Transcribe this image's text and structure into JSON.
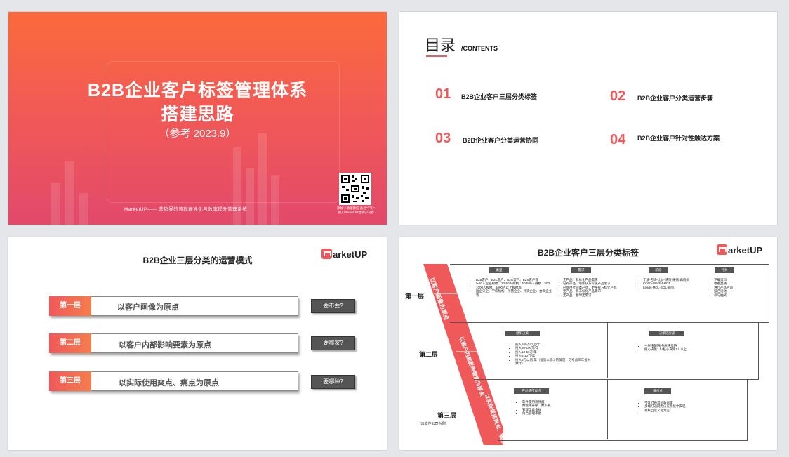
{
  "slide1": {
    "title_line1": "B2B企业客户标签管理体系",
    "title_line2": "搭建思路",
    "subtitle": "（参考   2023.9）",
    "footer": "MarketUP——  营销界的流程标准化与效率提升管理系统",
    "qr_caption_1": "添加小助理微信 备注\"学习\"",
    "qr_caption_2": "加入MarketUP营销学习群"
  },
  "slide2": {
    "title": "目录",
    "title_en": "/CONTENTS",
    "items": [
      {
        "num": "01",
        "text": "B2B企业客户三层分类标签"
      },
      {
        "num": "02",
        "text": "B2B企业客户分类运营步骤"
      },
      {
        "num": "03",
        "text": "B2B企业客户分类运营协同"
      },
      {
        "num": "04",
        "text": "B2B企业客户针对性触达方案"
      }
    ]
  },
  "slide3": {
    "title": "B2B企业三层分类的运营模式",
    "logo": "arketUP",
    "layers": [
      {
        "tag": "第一层",
        "text": "以客户画像为原点",
        "question": "要不要?"
      },
      {
        "tag": "第二层",
        "text": "以客户内部影响要素为原点",
        "question": "要哪家?"
      },
      {
        "tag": "第三层",
        "text": "以实际使用爽点、痛点为原点",
        "question": "要哪种?"
      }
    ]
  },
  "slide4": {
    "title": "B2B企业客户三层分类标签",
    "logo": "arketUP",
    "levels": [
      "第一层",
      "第二层",
      "第三层"
    ],
    "level3_note": "(以软件公司为例)",
    "bands": [
      "以客户画像为原点",
      "以客户内部影响要素为原点",
      "以实际使用爽点、痛点为原点"
    ],
    "row1": [
      {
        "header": "类型",
        "items": [
          "B2B客户、B2C客户、B2G客户、B2S客户等",
          "0-20人企业规模、20-50人规模、50-500人规模、500-1000人规模、1000人以上规模等",
          "国企央企、学校机构、民营企业、外资企业、合资企业等"
        ]
      },
      {
        "header": "需求",
        "items": [
          "无产品、有标化产品需求",
          "已有产品，增加获方标化产品需求",
          "已使用过同类产品，更换提方标化产品",
          "无产品、有非标化产品需求",
          "无产品，暂时无需求"
        ]
      },
      {
        "header": "阶段",
        "items": [
          "了解-咨询-比价-决策-采购-再购买",
          "COLD-WARM-HOT",
          "Leads-MQL-SQL-商机"
        ]
      },
      {
        "header": "行为",
        "items": [
          "下载资料",
          "收看直播",
          "进行产品咨询",
          "报名活动",
          "参与抽奖"
        ]
      }
    ],
    "row2": [
      {
        "header": "组织决策",
        "items": [
          "投入100万以上/年",
          "投入50-100万/年",
          "投入10-50万/年",
          "投入5-10万/年",
          "投入5万以内/年（投资人较少的情况，可考虑三年投入预计）"
        ]
      },
      {
        "header": "决策链层级",
        "items": [
          "一层决策链/多层决策链",
          "核心决策1人/核心决策1人以上"
        ]
      }
    ],
    "row3": [
      {
        "header": "产品使用爽点",
        "items": [
          "软件使用流畅度",
          "数据库升级、数下载",
          "管理工具多样",
          "角色管理丰富"
        ]
      },
      {
        "header": "痛点点",
        "items": [
          "不爱打通其他数据库",
          "多端打通网无法在系统中实现",
          "系统自定义能力差"
        ]
      }
    ]
  }
}
